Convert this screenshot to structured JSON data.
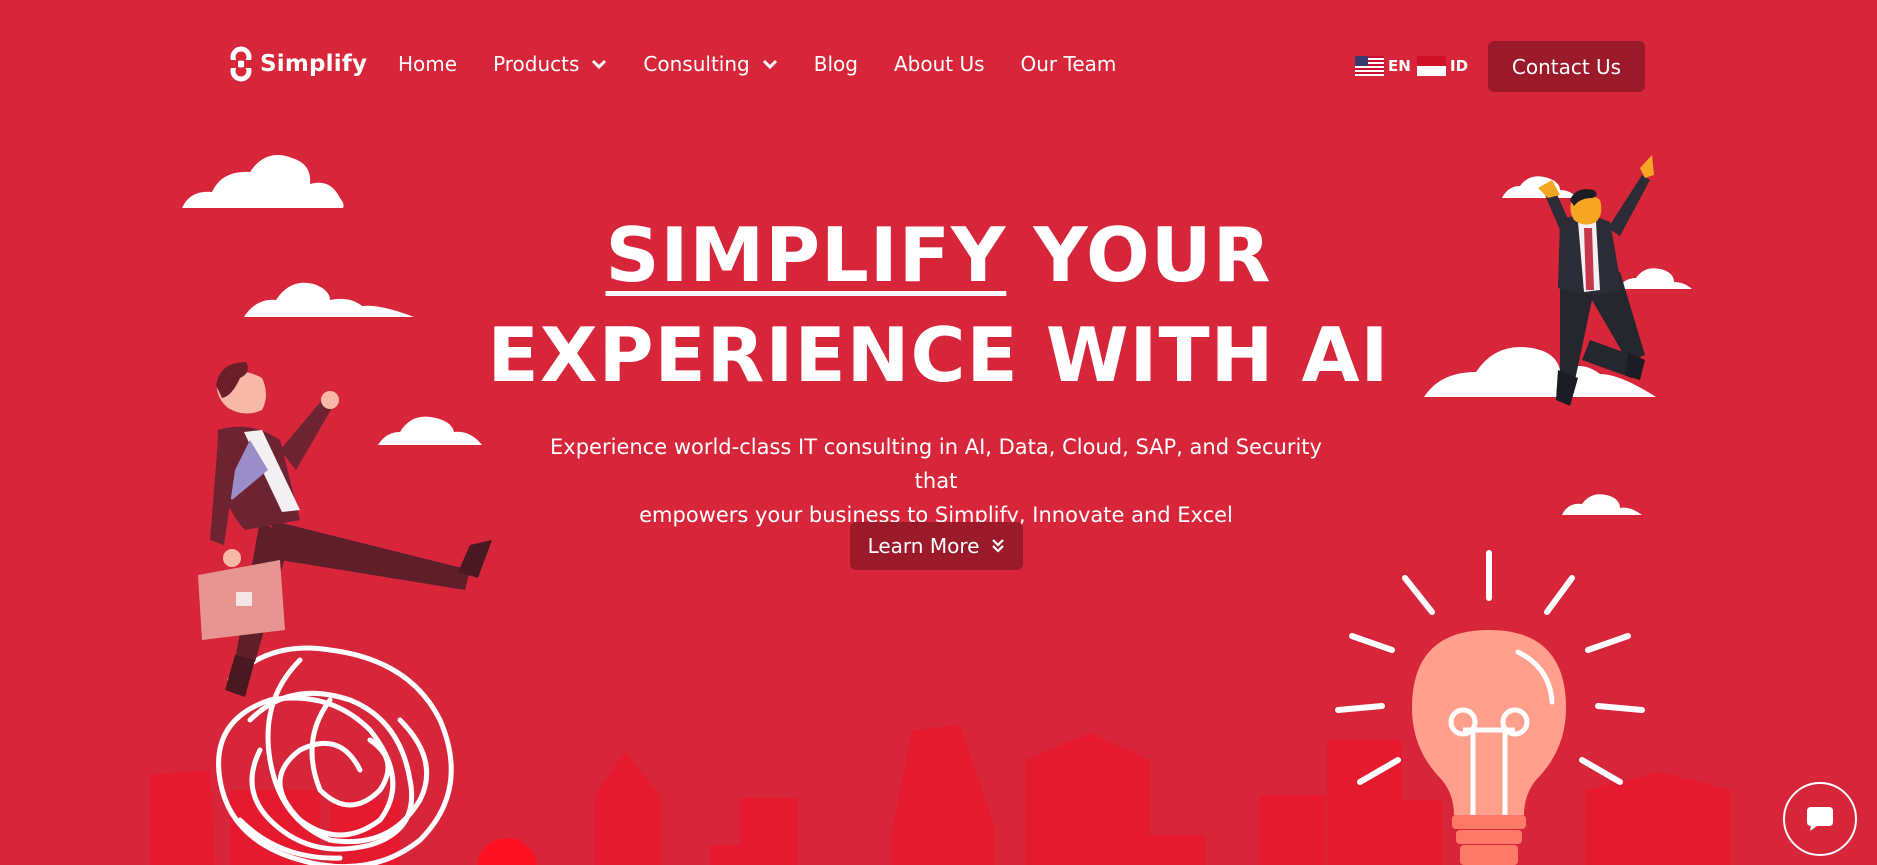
{
  "brand": {
    "name": "Simplify"
  },
  "nav": {
    "items": [
      {
        "label": "Home"
      },
      {
        "label": "Products",
        "has_dropdown": true
      },
      {
        "label": "Consulting",
        "has_dropdown": true
      },
      {
        "label": "Blog"
      },
      {
        "label": "About Us"
      },
      {
        "label": "Our Team"
      }
    ],
    "languages": [
      {
        "code": "EN",
        "flag": "us-flag-icon"
      },
      {
        "code": "ID",
        "flag": "indonesia-flag-icon"
      }
    ],
    "contact_label": "Contact Us"
  },
  "hero": {
    "title_highlight": "SIMPLIFY",
    "title_rest_line1": " YOUR",
    "title_line2": "EXPERIENCE WITH AI",
    "subtitle_line1": "Experience world-class IT consulting in AI, Data, Cloud, SAP, and Security that",
    "subtitle_line2": "empowers your business to Simplify, Innovate and Excel",
    "cta_label": "Learn More"
  },
  "icons": {
    "logo": "simplify-logo-icon",
    "chevron": "chevron-down-icon",
    "double_chevron": "double-chevron-down-icon",
    "chat": "chat-bubble-icon"
  },
  "colors": {
    "background": "#d7263a",
    "button": "#9b1a2a",
    "skyline": "#e51a2f",
    "bulb": "#ff9f8c",
    "text": "#ffffff"
  }
}
